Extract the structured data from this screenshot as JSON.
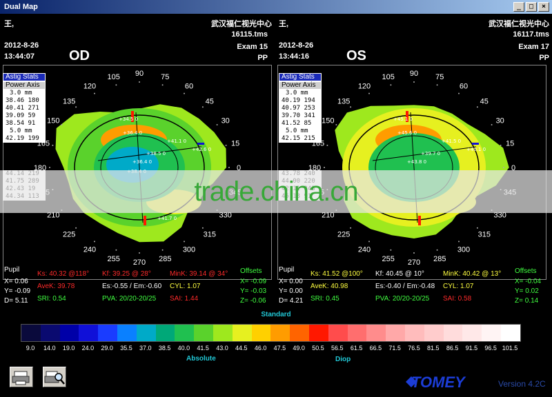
{
  "window": {
    "title": "Dual Map",
    "min": "_",
    "max": "□",
    "close": "×"
  },
  "colors": {
    "watermark": "#38a838",
    "accent_cyan": "#21c8d6",
    "brand_blue": "#1c3dd6"
  },
  "left": {
    "patient": "王, ",
    "clinic": "武汉福仁视光中心",
    "file": "16115.tms",
    "date": "2012-8-26",
    "time": "13:44:07",
    "exam": "Exam 15",
    "pp": "PP",
    "eye": "OD",
    "stats_btn1": "Astig Stats",
    "stats_btn2": "Power Axis",
    "stats_rows": [
      "3.0 mm",
      "38.46 180",
      "40.41 271",
      "39.09  59",
      "38.54  91",
      "5.0 mm",
      "42.19 199"
    ],
    "stats_rows_lower": [
      "44.14 219",
      "41.75 289",
      "42.43  19",
      "44.34 113"
    ],
    "pupil": "Pupil",
    "x": "X=  0.06",
    "y": "Y=  -0.09",
    "d": "D=  5.11",
    "ks": "Ks: 40.32 @118°",
    "kf": "Kf: 39.25 @ 28°",
    "mink": "MinK: 39.14 @ 34°",
    "avek": "AveK: 39.78",
    "es": "Es:-0.55 / Em:-0.60",
    "cyl": "CYL: 1.07",
    "sri": "SRI: 0.54",
    "pva": "PVA: 20/20-20/25",
    "sai": "SAI: 1.44",
    "offsets": "Offsets",
    "ox": "X= -0.09",
    "oy": "Y= -0.03",
    "oz": "Z= -0.06",
    "markers": [
      "+34.5 0",
      "+36.4 0",
      "+41.1 0",
      "+42.6 0",
      "+38.5 0",
      "+36.4 0",
      "+38.4 0",
      "+41.7 0"
    ]
  },
  "right": {
    "patient": "王, ",
    "clinic": "武汉福仁视光中心",
    "file": "16117.tms",
    "date": "2012-8-26",
    "time": "13:44:16",
    "exam": "Exam 17",
    "pp": "PP",
    "eye": "OS",
    "stats_btn1": "Astig Stats",
    "stats_btn2": "Power Axis",
    "stats_rows": [
      "3.0 mm",
      "40.19 194",
      "40.97 253",
      "39.70 341",
      "41.52  85",
      "5.0 mm",
      "42.15 215"
    ],
    "stats_rows_lower": [
      "43.78 240",
      "44.00 220",
      "42.11 343",
      "45.13  91"
    ],
    "pupil": "Pupil",
    "x": "X=  0.00",
    "y": "Y=  0.00",
    "d": "D=  4.21",
    "ks": "Ks: 41.52 @100°",
    "kf": "Kf: 40.45 @ 10°",
    "mink": "MinK: 40.42 @ 13°",
    "avek": "AveK: 40.98",
    "es": "Es:-0.40 / Em:-0.48",
    "cyl": "CYL: 1.07",
    "sri": "SRI: 0.45",
    "pva": "PVA: 20/20-20/25",
    "sai": "SAI: 0.58",
    "offsets": "Offsets",
    "ox": "X= -0.04",
    "oy": "Y= 0.02",
    "oz": "Z= 0.14",
    "markers": [
      "+45.1 0",
      "+45.6 0",
      "+41.5 0",
      "+40.1 0",
      "+39.7 0",
      "+43.8 0"
    ]
  },
  "axis_degrees": [
    "0",
    "15",
    "30",
    "45",
    "60",
    "75",
    "90",
    "105",
    "120",
    "135",
    "150",
    "165",
    "180",
    "195",
    "210",
    "225",
    "240",
    "255",
    "270",
    "285",
    "300",
    "315",
    "330",
    "345"
  ],
  "watermark": "trade.china.cn",
  "scale": {
    "title": "Standard",
    "left_label": "Absolute",
    "right_label": "Diop",
    "ticks": [
      "9.0",
      "14.0",
      "19.0",
      "24.0",
      "29.0",
      "35.5",
      "37.0",
      "38.5",
      "40.0",
      "41.5",
      "43.0",
      "44.5",
      "46.0",
      "47.5",
      "49.0",
      "50.5",
      "56.5",
      "61.5",
      "66.5",
      "71.5",
      "76.5",
      "81.5",
      "86.5",
      "91.5",
      "96.5",
      "101.5"
    ],
    "colors": [
      "#0a0a3c",
      "#0a0a70",
      "#0000a8",
      "#1010d8",
      "#1a3cff",
      "#0a80ff",
      "#00aac8",
      "#00a878",
      "#20c050",
      "#5ad22c",
      "#9ee81e",
      "#e6f020",
      "#ffd000",
      "#ff9c00",
      "#ff6400",
      "#ff1800",
      "#ff4c4c",
      "#ff6e6e",
      "#ff8c8c",
      "#ffa8a8",
      "#ffbcbc",
      "#ffcccc",
      "#ffdcdc",
      "#ffe8e8",
      "#fff4f4",
      "#ffffff"
    ]
  },
  "brand": "TOMEY",
  "version": "Version 4.2C"
}
